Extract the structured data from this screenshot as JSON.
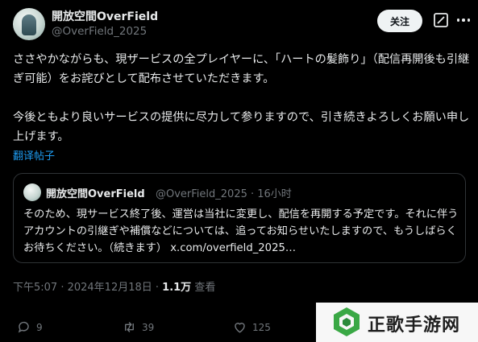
{
  "author": {
    "display_name": "開放空間OverField",
    "handle": "@OverField_2025"
  },
  "header": {
    "follow_label": "关注"
  },
  "tweet": {
    "paragraph_1": "ささやかながらも、現ザービスの全プレイヤーに、「ハートの髪飾り」（配信再開後も引継ぎ可能）をお詫びとして配布させていただきます。",
    "paragraph_2": "今後ともより良いサービスの提供に尽力して参りますので、引き続きよろしくお願い申し上げます。",
    "translate_label": "翻译帖子"
  },
  "quote": {
    "display_name": "開放空間OverField",
    "handle_time": "@OverField_2025 · 16小时",
    "text": "そのため、現サービス終了後、運営は当社に変更し、配信を再開する予定です。それに伴うアカウントの引継ぎや補償などについては、追ってお知らせいたしますので、もうしばらくお待ちください。（続きます）",
    "link": "x.com/overfield_2025…"
  },
  "meta": {
    "timestamp": "下午5:07 · 2024年12月18日 · ",
    "views_count": "1.1万",
    "views_label": " 查看"
  },
  "actions": {
    "replies": "9",
    "reposts": "39",
    "likes": "125"
  },
  "watermark": {
    "text": "正歌手游网"
  },
  "colors": {
    "background": "#000000",
    "text": "#e7e9ea",
    "secondary": "#71767b",
    "link": "#1d9bf0",
    "watermark_green": "#3aa845"
  }
}
